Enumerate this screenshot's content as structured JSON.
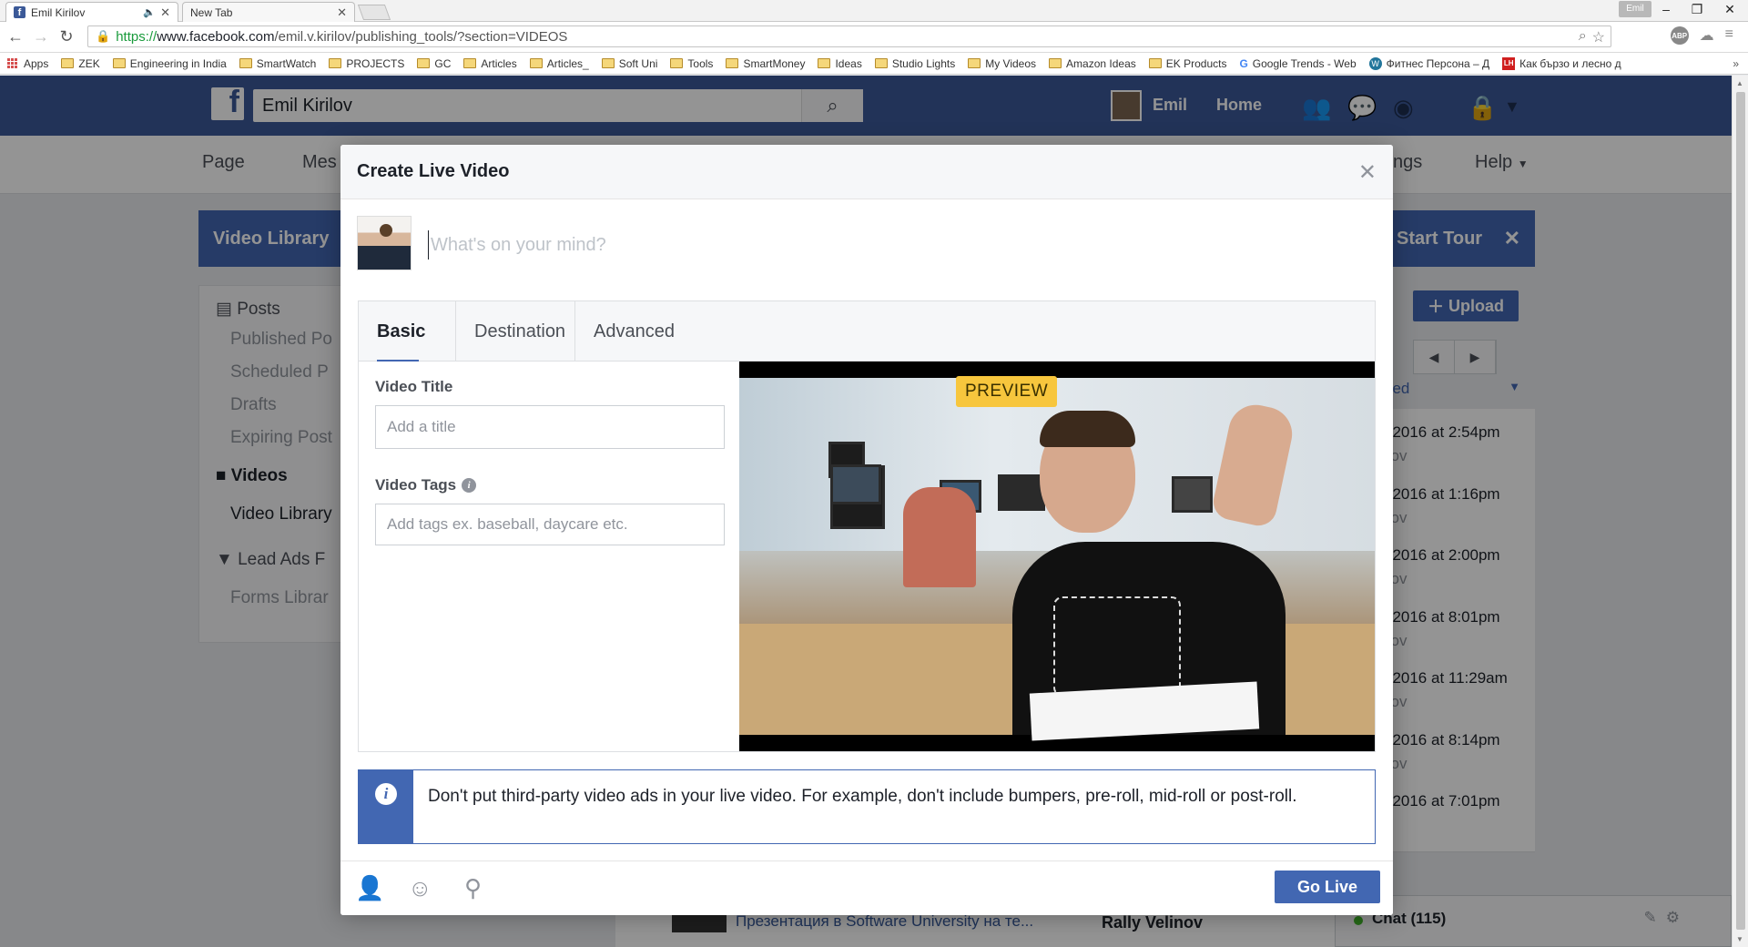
{
  "browser": {
    "tabs": [
      {
        "title": "Emil Kirilov",
        "favicon": "f"
      },
      {
        "title": "New Tab"
      }
    ],
    "window_user": "Emil",
    "url": {
      "protocol": "https://",
      "host": "www.facebook.com",
      "path": "/emil.v.kirilov/publishing_tools/?section=VIDEOS"
    },
    "bookmarks": [
      {
        "label": "Apps",
        "icon": "apps-grid-icon"
      },
      {
        "label": "ZEK",
        "icon": "folder-icon"
      },
      {
        "label": "Engineering in India",
        "icon": "folder-icon"
      },
      {
        "label": "SmartWatch",
        "icon": "folder-icon"
      },
      {
        "label": "PROJECTS",
        "icon": "folder-icon"
      },
      {
        "label": "GC",
        "icon": "folder-icon"
      },
      {
        "label": "Articles",
        "icon": "folder-icon"
      },
      {
        "label": "Articles_",
        "icon": "folder-icon"
      },
      {
        "label": "Soft Uni",
        "icon": "folder-icon"
      },
      {
        "label": "Tools",
        "icon": "folder-icon"
      },
      {
        "label": "SmartMoney",
        "icon": "folder-icon"
      },
      {
        "label": "Ideas",
        "icon": "folder-icon"
      },
      {
        "label": "Studio Lights",
        "icon": "folder-icon"
      },
      {
        "label": "My Videos",
        "icon": "folder-icon"
      },
      {
        "label": "Amazon Ideas",
        "icon": "folder-icon"
      },
      {
        "label": "EK Products",
        "icon": "folder-icon"
      },
      {
        "label": "Google Trends - Web",
        "icon": "google-icon"
      },
      {
        "label": "Фитнес Персона – Д",
        "icon": "wordpress-icon"
      },
      {
        "label": "Как бързо и лесно д",
        "icon": "lh-icon"
      }
    ]
  },
  "fb": {
    "search_value": "Emil Kirilov",
    "user_name": "Emil",
    "home_label": "Home",
    "pagenav": {
      "page": "Page",
      "messages": "Mes",
      "settings": "ngs",
      "help": "Help"
    },
    "sidebar": {
      "header": "Video Library",
      "posts": "Posts",
      "published": "Published Po",
      "scheduled": "Scheduled P",
      "drafts": "Drafts",
      "expiring": "Expiring Post",
      "videos": "Videos",
      "video_library": "Video Library",
      "lead_ads": "Lead Ads F",
      "forms_library": "Forms Librar"
    },
    "right": {
      "tour": "Start Tour",
      "upload": "Upload",
      "filter": "ded",
      "rows": [
        {
          "date": ", 2016 at 2:54pm",
          "by": "ilov"
        },
        {
          "date": ", 2016 at 1:16pm",
          "by": "ilov"
        },
        {
          "date": ", 2016 at 2:00pm",
          "by": "ilov"
        },
        {
          "date": ", 2016 at 8:01pm",
          "by": "ilov"
        },
        {
          "date": ", 2016 at 11:29am",
          "by": "ilov"
        },
        {
          "date": ", 2016 at 8:14pm",
          "by": "ilov"
        },
        {
          "date": ", 2016 at 7:01pm",
          "by": ""
        }
      ]
    },
    "bottom": {
      "video_title": "Презентация в Software University на те...",
      "video_author": "Rally Velinov",
      "chat": "Chat (115)"
    }
  },
  "modal": {
    "title": "Create Live Video",
    "composer_placeholder": "What's on your mind?",
    "tabs": [
      "Basic",
      "Destination",
      "Advanced"
    ],
    "active_tab": "Basic",
    "video_title_label": "Video Title",
    "video_title_placeholder": "Add a title",
    "video_tags_label": "Video Tags",
    "video_tags_placeholder": "Add tags ex. baseball, daycare etc.",
    "preview_badge": "PREVIEW",
    "notice": "Don't put third-party video ads in your live video. For example, don't include bumpers, pre-roll, mid-roll or post-roll.",
    "go_live": "Go Live"
  },
  "colors": {
    "fb_blue": "#3b5998",
    "button_blue": "#4267b2",
    "preview_yellow": "#f7c63d"
  }
}
